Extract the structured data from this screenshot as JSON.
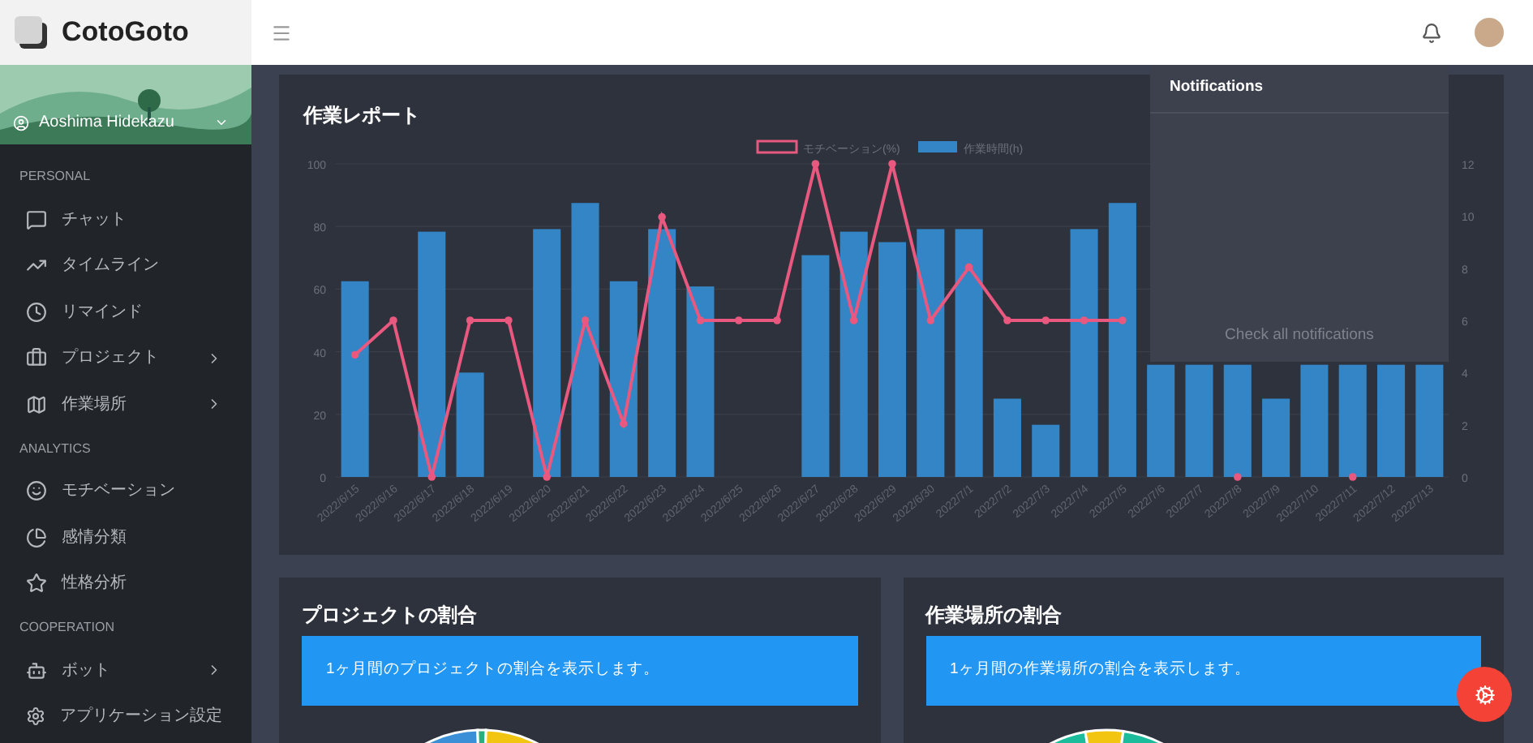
{
  "app": {
    "name": "CotoGoto"
  },
  "sidebar": {
    "user": {
      "name": "Aoshima Hidekazu"
    },
    "sections": [
      {
        "title": "PERSONAL",
        "items": [
          {
            "label": "チャット",
            "expandable": false
          },
          {
            "label": "タイムライン",
            "expandable": false
          },
          {
            "label": "リマインド",
            "expandable": false
          },
          {
            "label": "プロジェクト",
            "expandable": true
          },
          {
            "label": "作業場所",
            "expandable": true
          }
        ]
      },
      {
        "title": "ANALYTICS",
        "items": [
          {
            "label": "モチベーション",
            "expandable": false
          },
          {
            "label": "感情分類",
            "expandable": false
          },
          {
            "label": "性格分析",
            "expandable": false
          }
        ]
      },
      {
        "title": "COOPERATION",
        "items": [
          {
            "label": "ボット",
            "expandable": true
          },
          {
            "label": "アプリケーション設定",
            "expandable": false
          }
        ]
      }
    ]
  },
  "report": {
    "title": "作業レポート",
    "chart_data": {
      "type": "bar",
      "categories": [
        "2022/6/15",
        "2022/6/16",
        "2022/6/17",
        "2022/6/18",
        "2022/6/19",
        "2022/6/20",
        "2022/6/21",
        "2022/6/22",
        "2022/6/23",
        "2022/6/24",
        "2022/6/25",
        "2022/6/26",
        "2022/6/27",
        "2022/6/28",
        "2022/6/29",
        "2022/6/30",
        "2022/7/1",
        "2022/7/2",
        "2022/7/3",
        "2022/7/4",
        "2022/7/5",
        "2022/7/6",
        "2022/7/7",
        "2022/7/8",
        "2022/7/9",
        "2022/7/10",
        "2022/7/11",
        "2022/7/12",
        "2022/7/13"
      ],
      "series": [
        {
          "name": "モチベーション(%)",
          "color": "#e8587f",
          "type": "line",
          "marker": "circle",
          "values": [
            39,
            50,
            0,
            50,
            50,
            0,
            50,
            17,
            83,
            50,
            50,
            50,
            100,
            50,
            100,
            50,
            67,
            50,
            50,
            50,
            50,
            null,
            null,
            0,
            null,
            null,
            0,
            null,
            null
          ]
        },
        {
          "name": "作業時間(h)",
          "color": "#3385c6",
          "type": "bar",
          "axis": "y2",
          "values": [
            7.5,
            0,
            9.4,
            4,
            0,
            9.5,
            10.5,
            7.5,
            9.5,
            7.3,
            0,
            0,
            8.5,
            9.4,
            9,
            9.5,
            9.5,
            3,
            2,
            9.5,
            10.5,
            4.3,
            4.3,
            4.3,
            3,
            4.3,
            4.3,
            4.3,
            4.3
          ]
        }
      ],
      "grid": true,
      "legend": true,
      "ylim": [
        0,
        100
      ],
      "yticks": [
        0,
        20,
        40,
        60,
        80,
        100
      ],
      "y2lim": [
        0,
        12
      ],
      "y2ticks": [
        0,
        2,
        4,
        6,
        8,
        10,
        12
      ]
    }
  },
  "notifications": {
    "title": "Notifications",
    "footer": "Check all notifications"
  },
  "cards": [
    {
      "title": "プロジェクトの割合",
      "info": "1ヶ月間のプロジェクトの割合を表示します。"
    },
    {
      "title": "作業場所の割合",
      "info": "1ヶ月間の作業場所の割合を表示します。"
    }
  ]
}
